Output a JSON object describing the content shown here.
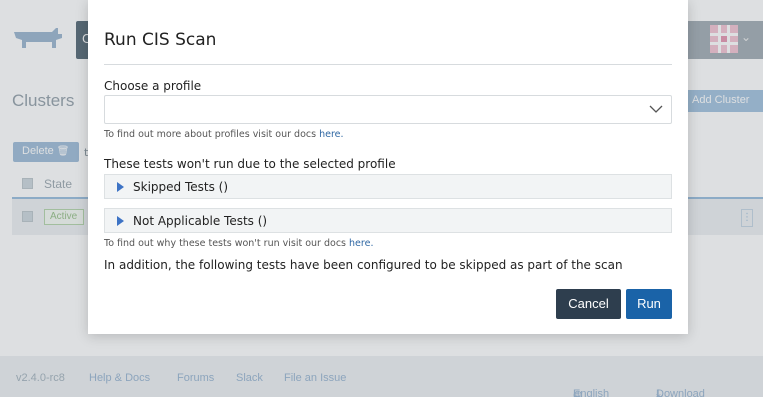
{
  "background": {
    "header": {
      "left_button_fragment": "C"
    },
    "page_title": "Clusters",
    "add_cluster_label": "Add Cluster",
    "delete_label": "Delete",
    "cut_text": "t",
    "table": {
      "state_header": "State",
      "rows": [
        {
          "state": "Active"
        }
      ]
    },
    "footer": {
      "version": "v2.4.0-rc8",
      "help": "Help & Docs",
      "forums": "Forums",
      "slack": "Slack",
      "issue": "File an Issue",
      "language": "English",
      "download": "Download CLI"
    }
  },
  "modal": {
    "title": "Run CIS Scan",
    "profile_label": "Choose a profile",
    "profile_value": "",
    "profile_hint_text": "To find out more about profiles visit our docs ",
    "profile_hint_link": "here.",
    "tests_label": "These tests won't run due to the selected profile",
    "skipped_tests": "Skipped Tests ()",
    "not_applicable_tests": "Not Applicable Tests ()",
    "why_hint_text": "To find out why these tests won't run visit our docs ",
    "why_hint_link": "here.",
    "addition_text": "In addition, the following tests have been configured to be skipped as part of the scan",
    "cancel_label": "Cancel",
    "run_label": "Run"
  }
}
